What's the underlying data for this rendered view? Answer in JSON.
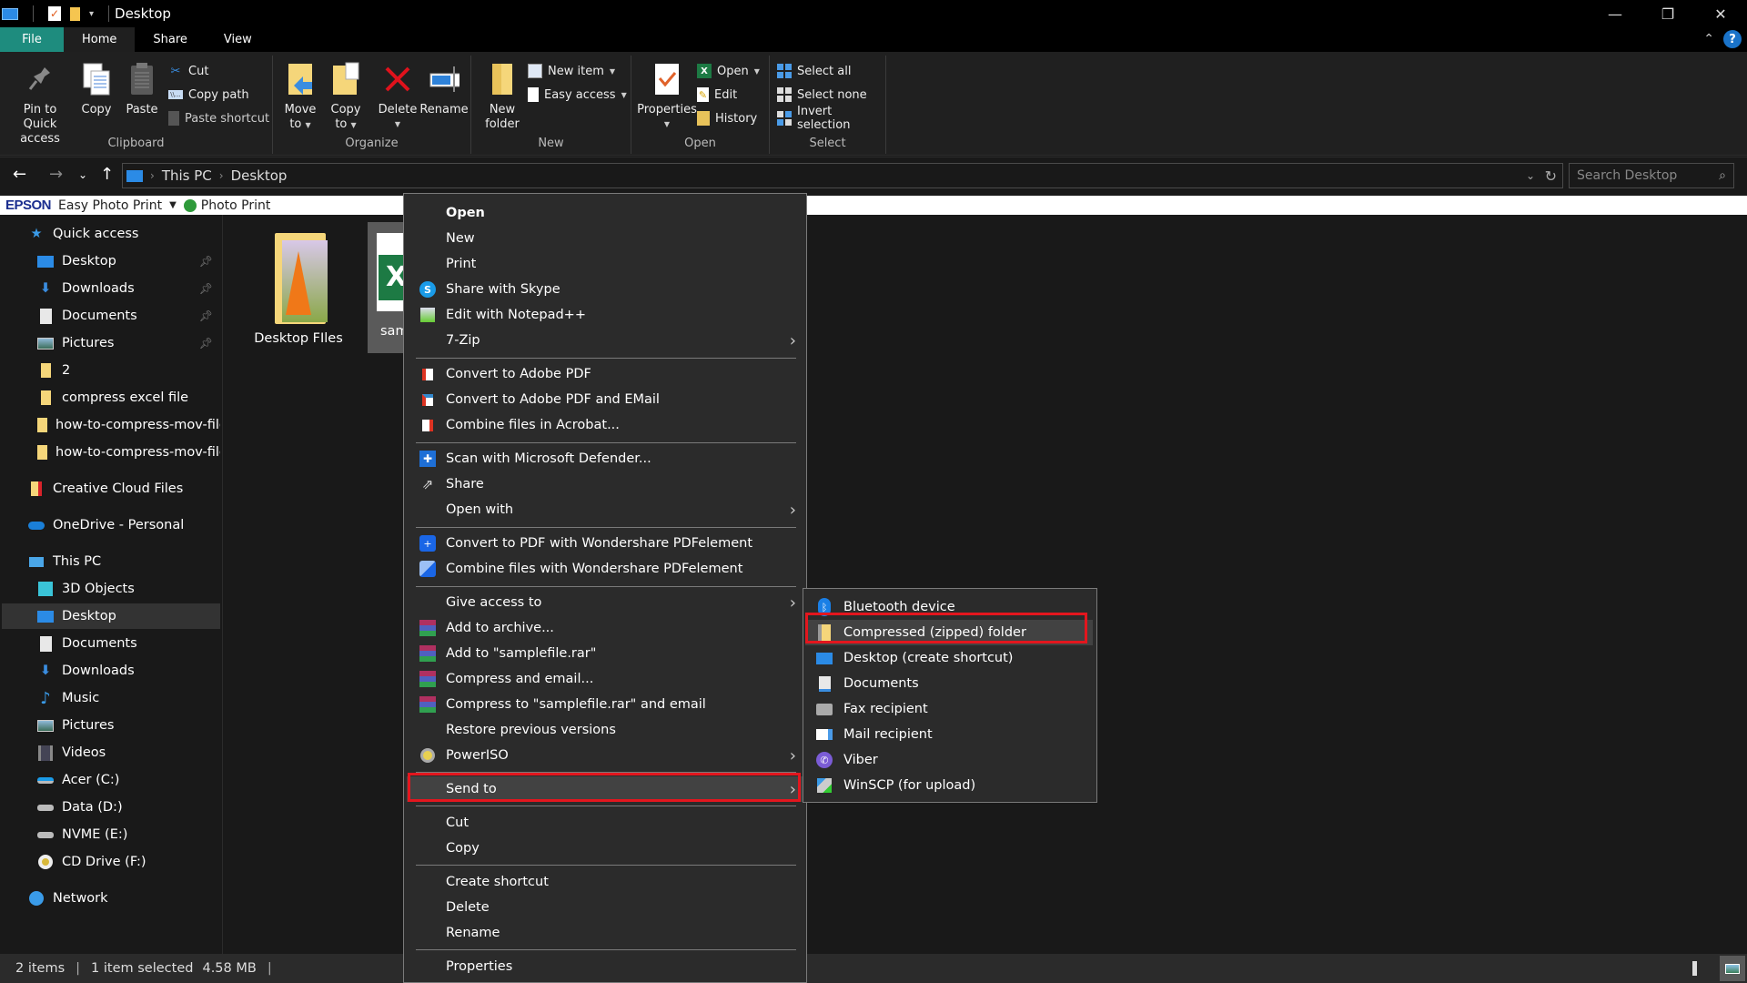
{
  "window": {
    "title": "Desktop",
    "controls": {
      "minimize": "—",
      "restore": "❐",
      "close": "✕"
    }
  },
  "tabs": [
    {
      "label": "File"
    },
    {
      "label": "Home"
    },
    {
      "label": "Share"
    },
    {
      "label": "View"
    }
  ],
  "ribbon": {
    "clipboard": {
      "label": "Clipboard",
      "pin": "Pin to Quick access",
      "pin_line1": "Pin to Quick",
      "pin_line2": "access",
      "copy": "Copy",
      "paste": "Paste",
      "cut": "Cut",
      "copy_path": "Copy path",
      "paste_shortcut": "Paste shortcut"
    },
    "organize": {
      "label": "Organize",
      "move_to_1": "Move",
      "move_to_2": "to",
      "copy_to_1": "Copy",
      "copy_to_2": "to",
      "delete": "Delete",
      "rename": "Rename"
    },
    "new": {
      "label": "New",
      "new_folder_1": "New",
      "new_folder_2": "folder",
      "new_item": "New item",
      "easy_access": "Easy access"
    },
    "open": {
      "label": "Open",
      "properties": "Properties",
      "open": "Open",
      "edit": "Edit",
      "history": "History"
    },
    "select": {
      "label": "Select",
      "select_all": "Select all",
      "select_none": "Select none",
      "invert": "Invert selection"
    }
  },
  "address": {
    "breadcrumbs": [
      "This PC",
      "Desktop"
    ],
    "search_placeholder": "Search Desktop"
  },
  "epson_bar": {
    "brand": "EPSON",
    "app": "Easy Photo Print",
    "action": "Photo Print"
  },
  "sidebar": {
    "items": [
      {
        "label": "Quick access",
        "icon": "star-icon",
        "pinned": false
      },
      {
        "label": "Desktop",
        "icon": "desktop-icon",
        "pinned": true
      },
      {
        "label": "Downloads",
        "icon": "download-icon",
        "pinned": true
      },
      {
        "label": "Documents",
        "icon": "documents-icon",
        "pinned": true
      },
      {
        "label": "Pictures",
        "icon": "pictures-icon",
        "pinned": true
      },
      {
        "label": "2",
        "icon": "folder-icon",
        "pinned": false
      },
      {
        "label": "compress excel file",
        "icon": "folder-icon",
        "pinned": false
      },
      {
        "label": "how-to-compress-mov-file",
        "icon": "folder-icon",
        "pinned": false
      },
      {
        "label": "how-to-compress-mov-file",
        "icon": "folder-icon",
        "pinned": false
      },
      {
        "label": "Creative Cloud Files",
        "icon": "creative-cloud-icon",
        "pinned": false
      },
      {
        "label": "OneDrive - Personal",
        "icon": "onedrive-icon",
        "pinned": false
      },
      {
        "label": "This PC",
        "icon": "this-pc-icon",
        "pinned": false
      },
      {
        "label": "3D Objects",
        "icon": "3d-objects-icon",
        "pinned": false
      },
      {
        "label": "Desktop",
        "icon": "desktop-icon",
        "pinned": false,
        "selected": true
      },
      {
        "label": "Documents",
        "icon": "documents-icon",
        "pinned": false
      },
      {
        "label": "Downloads",
        "icon": "download-icon",
        "pinned": false
      },
      {
        "label": "Music",
        "icon": "music-icon",
        "pinned": false
      },
      {
        "label": "Pictures",
        "icon": "pictures-icon",
        "pinned": false
      },
      {
        "label": "Videos",
        "icon": "videos-icon",
        "pinned": false
      },
      {
        "label": "Acer (C:)",
        "icon": "drive-c-icon",
        "pinned": false
      },
      {
        "label": "Data (D:)",
        "icon": "drive-icon",
        "pinned": false
      },
      {
        "label": "NVME (E:)",
        "icon": "drive-icon",
        "pinned": false
      },
      {
        "label": "CD Drive (F:)",
        "icon": "cd-drive-icon",
        "pinned": false
      },
      {
        "label": "Network",
        "icon": "network-icon",
        "pinned": false
      }
    ]
  },
  "files": [
    {
      "name": "Desktop FIles",
      "type": "folder"
    },
    {
      "name": "sam",
      "type": "excel",
      "selected": true
    }
  ],
  "context_menu": {
    "items": [
      {
        "label": "Open",
        "bold": true
      },
      {
        "label": "New"
      },
      {
        "label": "Print"
      },
      {
        "label": "Share with Skype",
        "icon": "skype-icon"
      },
      {
        "label": "Edit with Notepad++",
        "icon": "notepadpp-icon"
      },
      {
        "label": "7-Zip",
        "submenu": true
      },
      {
        "label": "Convert to Adobe PDF",
        "icon": "acrobat-icon"
      },
      {
        "label": "Convert to Adobe PDF and EMail",
        "icon": "acrobat-email-icon"
      },
      {
        "label": "Combine files in Acrobat...",
        "icon": "acrobat-combine-icon"
      },
      {
        "label": "Scan with Microsoft Defender...",
        "icon": "defender-icon"
      },
      {
        "label": "Share",
        "icon": "share-icon"
      },
      {
        "label": "Open with",
        "submenu": true
      },
      {
        "label": "Convert to PDF with Wondershare PDFelement",
        "icon": "pdfelement-icon"
      },
      {
        "label": "Combine files with Wondershare PDFelement",
        "icon": "pdfelement-combine-icon"
      },
      {
        "label": "Give access to",
        "submenu": true
      },
      {
        "label": "Add to archive...",
        "icon": "winrar-icon"
      },
      {
        "label": "Add to \"samplefile.rar\"",
        "icon": "winrar-icon"
      },
      {
        "label": "Compress and email...",
        "icon": "winrar-icon"
      },
      {
        "label": "Compress to \"samplefile.rar\" and email",
        "icon": "winrar-icon"
      },
      {
        "label": "Restore previous versions"
      },
      {
        "label": "PowerISO",
        "icon": "poweriso-icon",
        "submenu": true
      },
      {
        "label": "Send to",
        "submenu": true,
        "highlighted": true
      },
      {
        "label": "Cut"
      },
      {
        "label": "Copy"
      },
      {
        "label": "Create shortcut"
      },
      {
        "label": "Delete"
      },
      {
        "label": "Rename"
      },
      {
        "label": "Properties"
      }
    ]
  },
  "send_to_menu": {
    "items": [
      {
        "label": "Bluetooth device",
        "icon": "bluetooth-icon"
      },
      {
        "label": "Compressed (zipped) folder",
        "icon": "zip-folder-icon",
        "highlighted": true
      },
      {
        "label": "Desktop (create shortcut)",
        "icon": "desktop-icon"
      },
      {
        "label": "Documents",
        "icon": "documents-icon"
      },
      {
        "label": "Fax recipient",
        "icon": "fax-icon"
      },
      {
        "label": "Mail recipient",
        "icon": "mail-icon"
      },
      {
        "label": "Viber",
        "icon": "viber-icon"
      },
      {
        "label": "WinSCP (for upload)",
        "icon": "winscp-icon"
      }
    ]
  },
  "status": {
    "items_count": "2 items",
    "selected": "1 item selected",
    "size": "4.58 MB"
  },
  "colors": {
    "file_tab": "#1e8c7e",
    "highlight_box": "#e3161e",
    "accent_blue": "#1a73c9"
  }
}
